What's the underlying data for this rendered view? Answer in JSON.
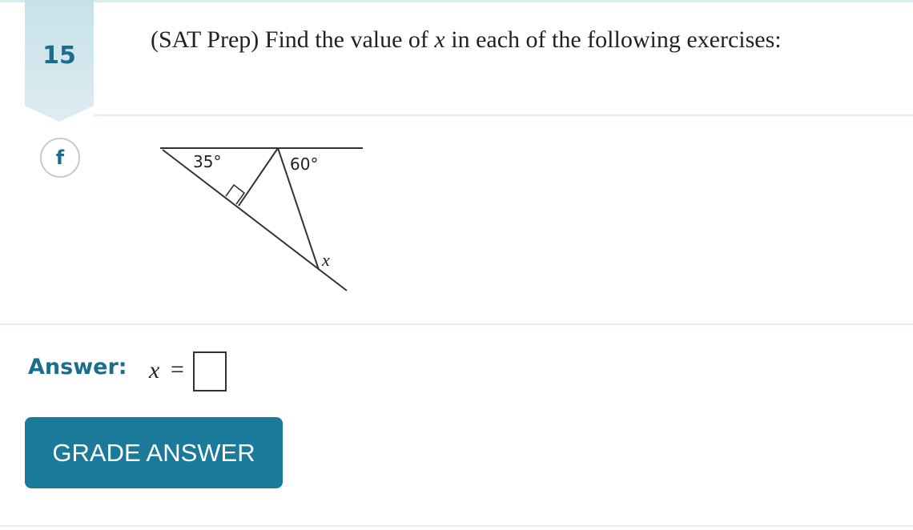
{
  "question": {
    "number": "15",
    "text_before": "(SAT Prep) Find the value of ",
    "variable": "x",
    "text_after": " in each of the following exercises:"
  },
  "part": {
    "label": "f"
  },
  "diagram": {
    "angle_left": "35°",
    "angle_right": "60°",
    "unknown": "x"
  },
  "answer": {
    "label": "Answer:",
    "variable": "x",
    "equals": "=",
    "value": ""
  },
  "button": {
    "label": "GRADE ANSWER"
  },
  "colors": {
    "accent": "#1b7a9a",
    "tab": "#c8e1e8",
    "divider": "#e3eef1"
  }
}
